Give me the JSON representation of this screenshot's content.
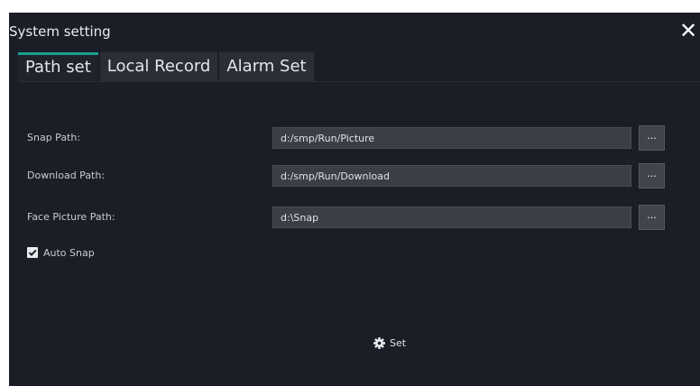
{
  "window": {
    "title": "System setting"
  },
  "tabs": [
    {
      "label": "Path set",
      "active": true
    },
    {
      "label": "Local Record",
      "active": false
    },
    {
      "label": "Alarm Set",
      "active": false
    }
  ],
  "paths": [
    {
      "label": "Snap Path:",
      "value": "d:/smp/Run/Picture",
      "button": "..."
    },
    {
      "label": "Download Path:",
      "value": "d:/smp/Run/Download",
      "button": "..."
    },
    {
      "label": "Face Picture Path:",
      "value": "d:\\Snap",
      "button": "..."
    }
  ],
  "auto_snap": {
    "label": "Auto Snap",
    "checked": true
  },
  "set_button": {
    "label": "Set",
    "icon": "gear-icon"
  },
  "colors": {
    "background": "#1b1e26",
    "tab_active_accent": "#17a090",
    "input_background": "#3b3e45"
  }
}
